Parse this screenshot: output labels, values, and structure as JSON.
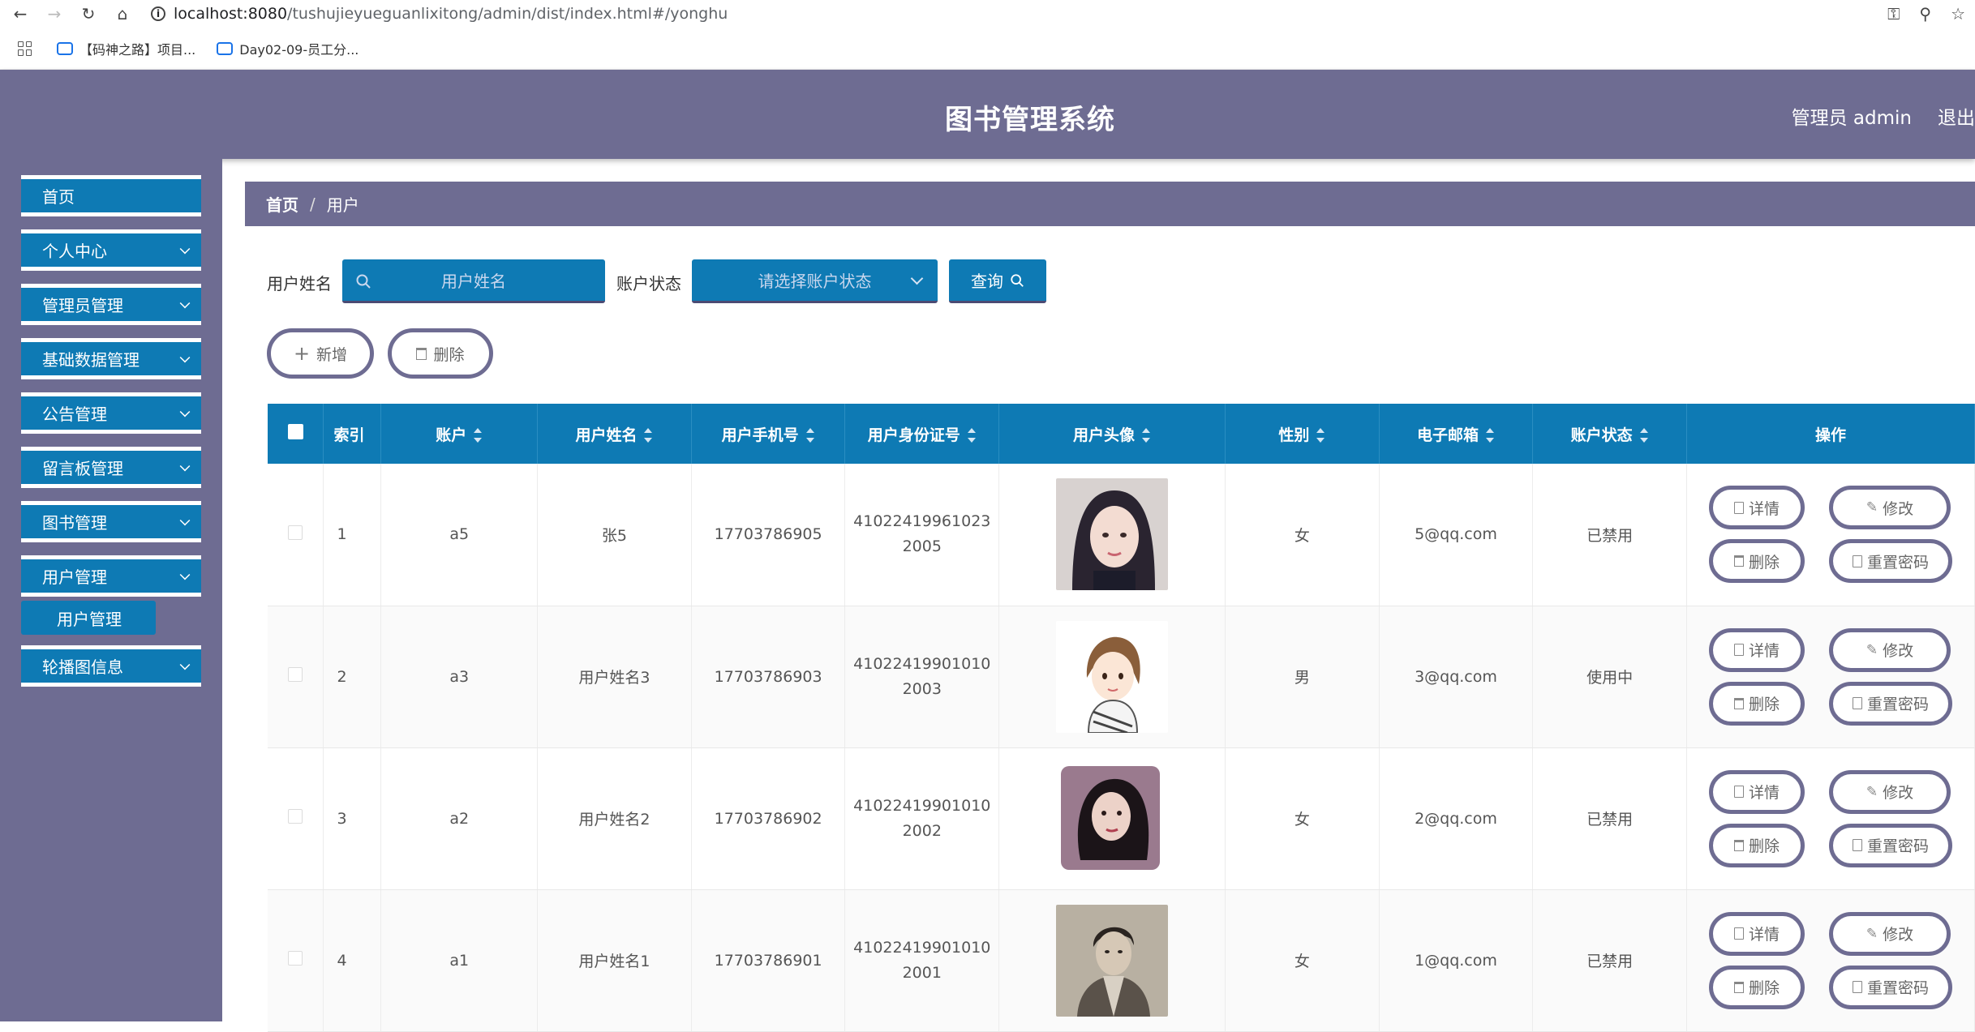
{
  "browser": {
    "url_host": "localhost:8080",
    "url_path": "/tushujieyueguanlixitong/admin/dist/index.html#/yonghu",
    "bookmarks": [
      "【码神之路】项目...",
      "Day02-09-员工分..."
    ]
  },
  "header": {
    "title": "图书管理系统",
    "user": "管理员 admin",
    "logout": "退出"
  },
  "sidebar": {
    "items": [
      {
        "label": "首页"
      },
      {
        "label": "个人中心"
      },
      {
        "label": "管理员管理"
      },
      {
        "label": "基础数据管理"
      },
      {
        "label": "公告管理"
      },
      {
        "label": "留言板管理"
      },
      {
        "label": "图书管理"
      },
      {
        "label": "用户管理"
      },
      {
        "label": "轮播图信息"
      }
    ],
    "sub_item": "用户管理"
  },
  "breadcrumb": {
    "home": "首页",
    "sep": "/",
    "current": "用户"
  },
  "search": {
    "name_label": "用户姓名",
    "name_placeholder": "用户姓名",
    "status_label": "账户状态",
    "status_placeholder": "请选择账户状态",
    "query_label": "查询"
  },
  "actions": {
    "add": "新增",
    "delete": "删除"
  },
  "table": {
    "headers": [
      "索引",
      "账户",
      "用户姓名",
      "用户手机号",
      "用户身份证号",
      "用户头像",
      "性别",
      "电子邮箱",
      "账户状态",
      "操作"
    ],
    "op_labels": {
      "detail": "详情",
      "edit": "修改",
      "delete": "删除",
      "reset": "重置密码"
    },
    "rows": [
      {
        "index": "1",
        "account": "a5",
        "name": "张5",
        "phone": "17703786905",
        "id_card_1": "41022419961023",
        "id_card_2": "2005",
        "avatar": "avatar-1",
        "gender": "女",
        "email": "5@qq.com",
        "status": "已禁用"
      },
      {
        "index": "2",
        "account": "a3",
        "name": "用户姓名3",
        "phone": "17703786903",
        "id_card_1": "41022419901010",
        "id_card_2": "2003",
        "avatar": "avatar-2",
        "gender": "男",
        "email": "3@qq.com",
        "status": "使用中"
      },
      {
        "index": "3",
        "account": "a2",
        "name": "用户姓名2",
        "phone": "17703786902",
        "id_card_1": "41022419901010",
        "id_card_2": "2002",
        "avatar": "avatar-3",
        "gender": "女",
        "email": "2@qq.com",
        "status": "已禁用"
      },
      {
        "index": "4",
        "account": "a1",
        "name": "用户姓名1",
        "phone": "17703786901",
        "id_card_1": "41022419901010",
        "id_card_2": "2001",
        "avatar": "avatar-4",
        "gender": "女",
        "email": "1@qq.com",
        "status": "已禁用"
      }
    ]
  },
  "colors": {
    "primary": "#0e7ab4",
    "chrome": "#6e6c92"
  }
}
